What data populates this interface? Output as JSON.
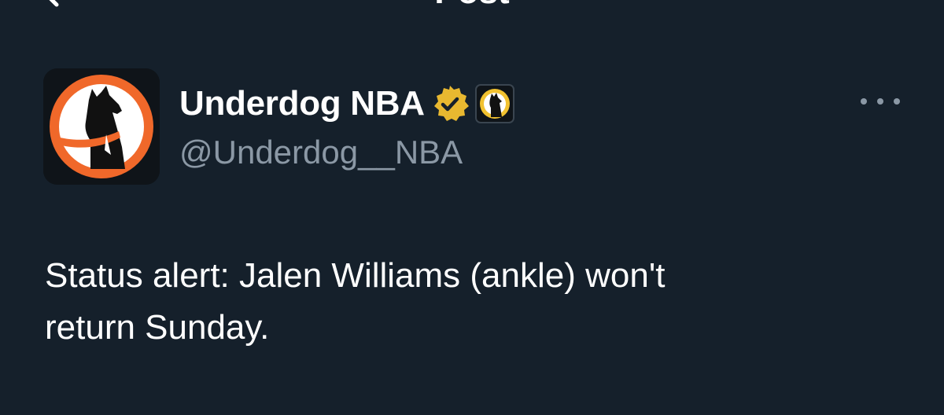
{
  "header": {
    "title": "Post",
    "back_icon": "chevron-left-icon"
  },
  "author": {
    "display_name": "Underdog NBA",
    "handle": "@Underdog__NBA",
    "avatar_icon": "underdog-dog-logo",
    "verified_icon": "gold-verified-badge-icon",
    "affiliate_icon": "underdog-affiliate-badge-icon"
  },
  "post": {
    "line1": "Status alert: Jalen Williams (ankle) won't",
    "line2": "return Sunday."
  },
  "more_icon": "more-options-icon",
  "colors": {
    "background": "#15202b",
    "text_primary": "#ffffff",
    "text_secondary": "#8b98a5",
    "verified_gold": "#e8b830",
    "brand_orange": "#f0682a"
  }
}
